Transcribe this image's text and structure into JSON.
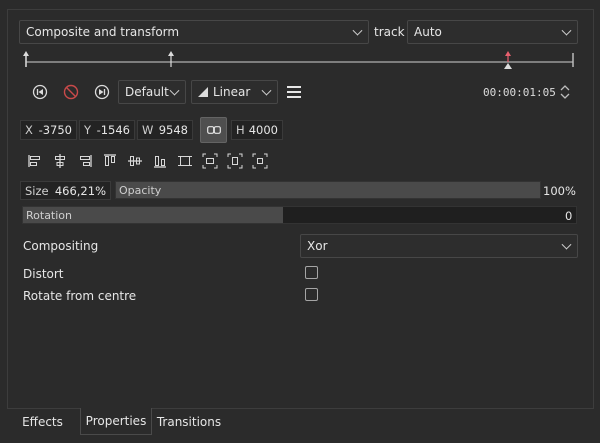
{
  "effect_selector": {
    "value": "Composite and transform"
  },
  "track_label": "track",
  "track_selector": {
    "value": "Auto"
  },
  "keyframe_toolbar": {
    "interpolation_default": "Default",
    "interpolation_curve": "Linear",
    "timecode": "00:00:01:05"
  },
  "transform": {
    "x_label": "X",
    "x_value": "-3750",
    "y_label": "Y",
    "y_value": "-1546",
    "w_label": "W",
    "w_value": "9548",
    "h_label": "H",
    "h_value": "4000"
  },
  "size": {
    "label": "Size",
    "value": "466,21%"
  },
  "opacity": {
    "label": "Opacity",
    "value": "100%",
    "fraction": 1.0
  },
  "rotation": {
    "label": "Rotation",
    "value": "0",
    "fraction": 0.47
  },
  "compositing": {
    "label": "Compositing",
    "value": "Xor"
  },
  "distort": {
    "label": "Distort",
    "checked": false
  },
  "rotate_from_centre": {
    "label": "Rotate from centre",
    "checked": false
  },
  "tabs": [
    {
      "label": "Effects",
      "active": false
    },
    {
      "label": "Properties",
      "active": true
    },
    {
      "label": "Transitions",
      "active": false
    }
  ],
  "colors": {
    "keyframe_selected": "#e8606e",
    "panel_bg": "#2b2b2b"
  }
}
